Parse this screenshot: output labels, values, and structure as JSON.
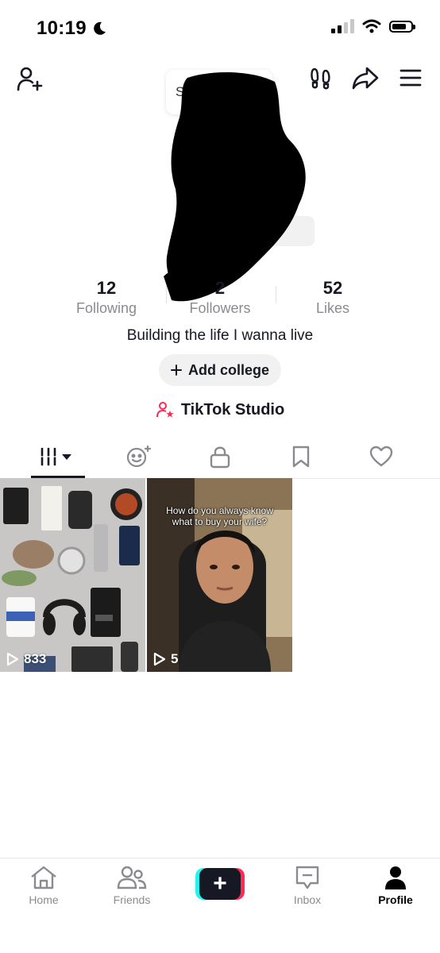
{
  "status_bar": {
    "time": "10:19"
  },
  "profile": {
    "name_fragment": "Sa",
    "bio": "Building the life I wanna live",
    "stats": [
      {
        "value": "12",
        "label": "Following"
      },
      {
        "value": "2",
        "label": "Followers"
      },
      {
        "value": "52",
        "label": "Likes"
      }
    ],
    "add_college_label": "Add college",
    "studio_label": "TikTok Studio"
  },
  "videos": [
    {
      "views": "833"
    },
    {
      "views": "5",
      "caption": "How do you always know what to buy your wife?"
    }
  ],
  "bottom_nav": {
    "items": [
      {
        "label": "Home"
      },
      {
        "label": "Friends"
      },
      {
        "label": "Inbox"
      },
      {
        "label": "Profile"
      }
    ]
  },
  "colors": {
    "accent": "#fe2c55",
    "cyan": "#25f4ee",
    "text": "#161823",
    "muted": "#8a8b91"
  }
}
